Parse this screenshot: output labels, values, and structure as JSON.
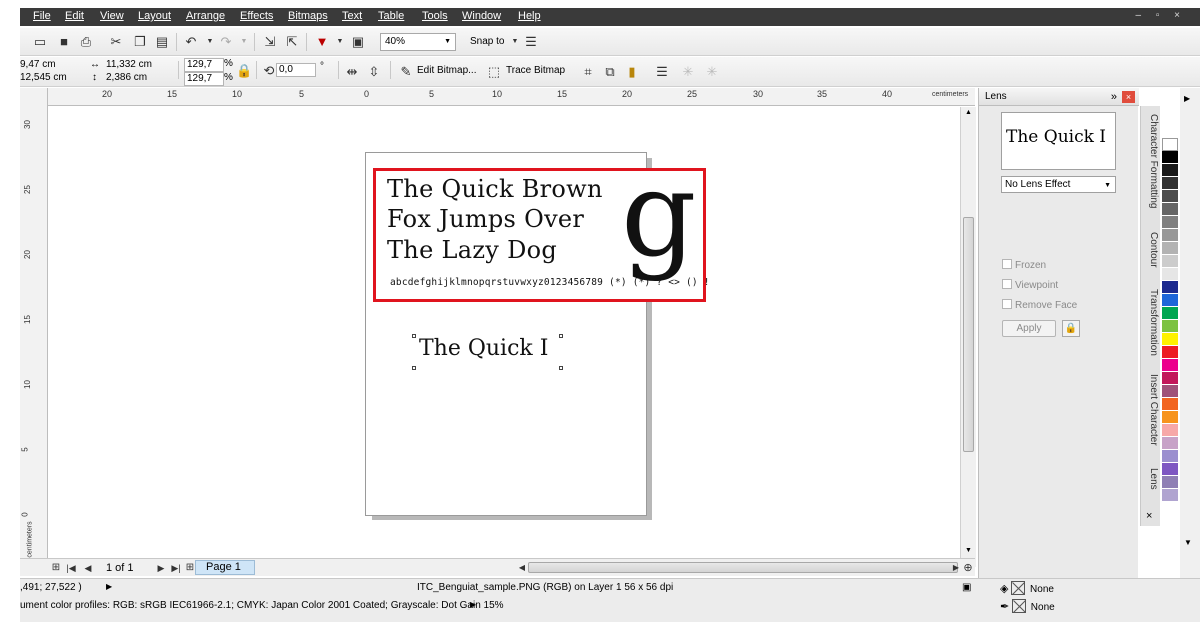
{
  "menu": [
    "File",
    "Edit",
    "View",
    "Layout",
    "Arrange",
    "Effects",
    "Bitmaps",
    "Text",
    "Table",
    "Tools",
    "Window",
    "Help"
  ],
  "window_controls": "– ▫ ×",
  "toolbar": {
    "zoom": "40%",
    "snap_to": "Snap to"
  },
  "property_bar": {
    "x": "9,47 cm",
    "y": "12,545 cm",
    "width": "11,332 cm",
    "height": "2,386 cm",
    "scale_x": "129,7",
    "scale_y": "129,7",
    "percent_1": "%",
    "percent_2": "%",
    "rotation": "0,0",
    "degree": "°",
    "edit_bitmap": "Edit Bitmap...",
    "trace_bitmap": "Trace Bitmap"
  },
  "ruler": {
    "top_labels": [
      "20",
      "15",
      "10",
      "5",
      "0",
      "5",
      "10",
      "15",
      "20",
      "25",
      "30",
      "35",
      "40"
    ],
    "unit": "centimeters",
    "left_labels": [
      "30",
      "25",
      "20",
      "15",
      "10",
      "5",
      "0"
    ],
    "left_unit": "centimeters"
  },
  "sample": {
    "line1": "The Quick Brown",
    "line2": "Fox Jumps Over",
    "line3": "The Lazy Dog",
    "glyph": "g",
    "alphabet": "abcdefghijklmnopqrstuvwxyz0123456789 (*) (*) ? <> () !"
  },
  "lens_object_text": "The Quick I",
  "pager": {
    "page_count": "1 of 1",
    "page_tab": "Page 1"
  },
  "docker": {
    "title": "Lens",
    "preview_text": "The Quick I",
    "effect": "No Lens Effect",
    "frozen": "Frozen",
    "viewpoint": "Viewpoint",
    "remove_face": "Remove Face",
    "apply": "Apply"
  },
  "docker_tabs": [
    "Character Formatting",
    "Contour",
    "Transformation",
    "Insert Character",
    "Lens"
  ],
  "palette": [
    "#ffffff",
    "#000000",
    "#1a1a1a",
    "#333333",
    "#4d4d4d",
    "#666666",
    "#808080",
    "#999999",
    "#b3b3b3",
    "#cccccc",
    "#e6e6e6",
    "#1d2a8f",
    "#1e66d8",
    "#00a651",
    "#7cc242",
    "#fff200",
    "#ed1c24",
    "#ec008c",
    "#c2185b",
    "#a0527a",
    "#f26522",
    "#f7941d",
    "#f7a8a8",
    "#c8a2c8",
    "#9b8fcf",
    "#7e57c2",
    "#8f7fb5",
    "#b0a4d0"
  ],
  "status": {
    "coords": ",491; 27,522 )",
    "object_info": "ITC_Benguiat_sample.PNG (RGB) on Layer 1 56 x 56 dpi",
    "color_profiles": "ument color profiles: RGB: sRGB IEC61966-2.1; CMYK: Japan Color 2001 Coated; Grayscale: Dot Gain 15%",
    "fill": "None",
    "outline": "None"
  }
}
